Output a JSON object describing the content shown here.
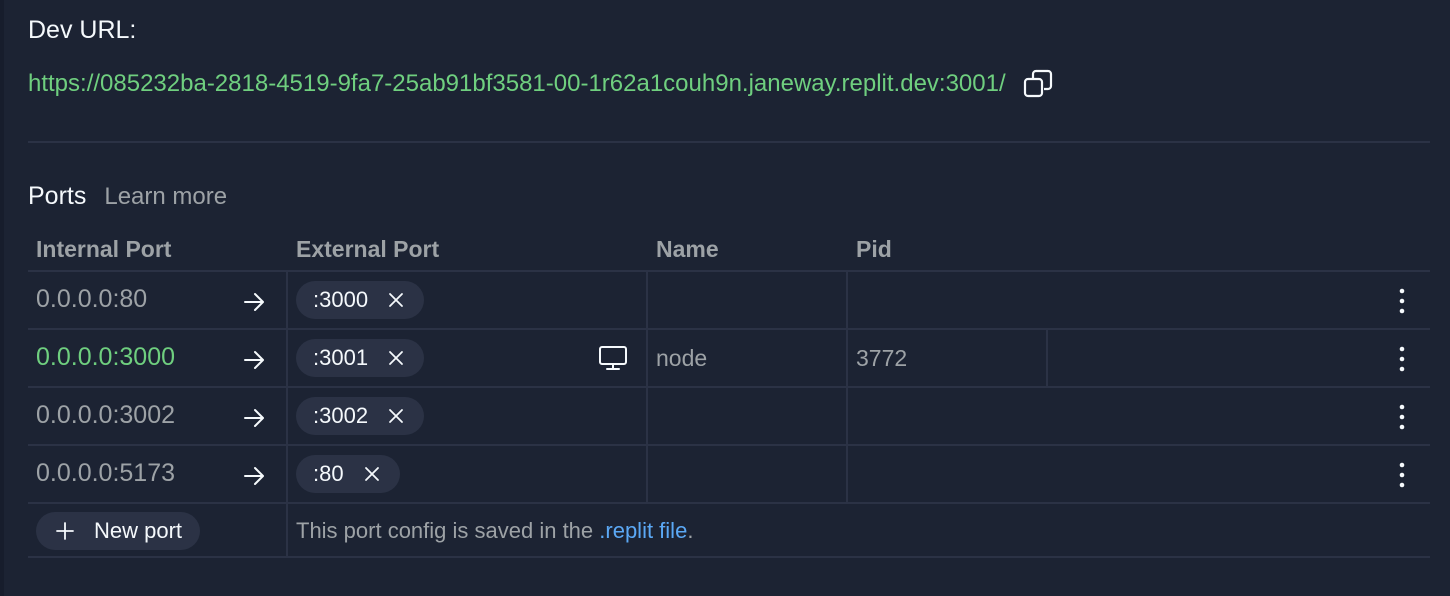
{
  "dev": {
    "label": "Dev URL:",
    "url": "https://085232ba-2818-4519-9fa7-25ab91bf3581-00-1r62a1couh9n.janeway.replit.dev:3001/",
    "copy_icon": "copy-icon"
  },
  "ports": {
    "title": "Ports",
    "learn_more": "Learn more",
    "headers": {
      "internal": "Internal Port",
      "external": "External Port",
      "name": "Name",
      "pid": "Pid"
    },
    "rows": [
      {
        "internal": "0.0.0.0:80",
        "external": ":3000",
        "name": "",
        "pid": "",
        "active": false
      },
      {
        "internal": "0.0.0.0:3000",
        "external": ":3001",
        "name": "node",
        "pid": "3772",
        "active": true
      },
      {
        "internal": "0.0.0.0:3002",
        "external": ":3002",
        "name": "",
        "pid": "",
        "active": false
      },
      {
        "internal": "0.0.0.0:5173",
        "external": ":80",
        "name": "",
        "pid": "",
        "active": false
      }
    ],
    "new_port_label": "New port",
    "saved_note_prefix": "This port config is saved in the ",
    "saved_note_link": ".replit file",
    "saved_note_suffix": "."
  },
  "colors": {
    "background": "#1c2333",
    "active_green": "#6fcf7f",
    "link_blue": "#5ba8f5",
    "chip_bg": "#2b3245",
    "muted_text": "#9da2a6"
  }
}
